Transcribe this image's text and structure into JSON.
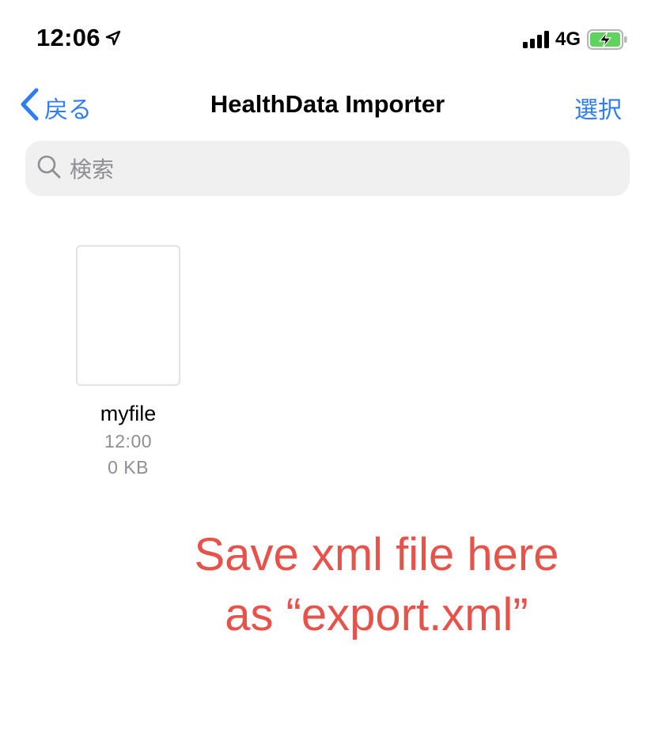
{
  "status_bar": {
    "time": "12:06",
    "location_icon": "location-arrow-icon",
    "network": "4G",
    "battery_icon": "battery-charging-icon",
    "signal_icon": "cellular-signal-icon"
  },
  "nav": {
    "back_label": "戻る",
    "title": "HealthData Importer",
    "select_label": "選択"
  },
  "search": {
    "placeholder": "検索",
    "icon": "search-icon"
  },
  "files": [
    {
      "name": "myfile",
      "time": "12:00",
      "size": "0 KB"
    }
  ],
  "annotation": {
    "line1": "Save xml file here",
    "line2": "as “export.xml”"
  },
  "colors": {
    "accent": "#2f7cf6",
    "annotation": "#e5534b",
    "secondary_text": "#8e8e93",
    "search_bg": "#f0f0f1",
    "battery_fill": "#5fd35b"
  }
}
